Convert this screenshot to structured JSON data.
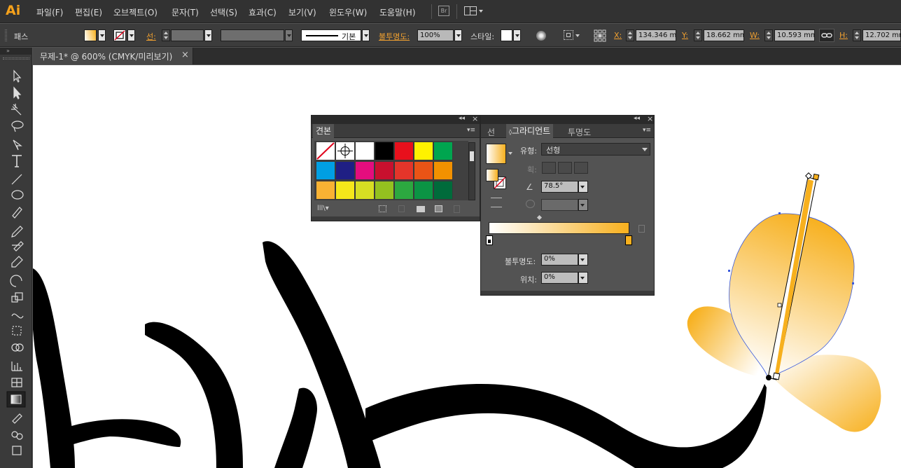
{
  "app": {
    "logo": "Ai"
  },
  "menu": [
    "파일(F)",
    "편집(E)",
    "오브젝트(O)",
    "문자(T)",
    "선택(S)",
    "효과(C)",
    "보기(V)",
    "윈도우(W)",
    "도움말(H)"
  ],
  "menu_icons": {
    "bridge": "Br"
  },
  "control": {
    "selection_label": "패스",
    "stroke_label": "선:",
    "stroke_style": "기본",
    "opacity_label": "불투명도:",
    "opacity_value": "100%",
    "style_label": "스타일:",
    "x_label": "X:",
    "x_value": "134.346 mm",
    "y_label": "Y:",
    "y_value": "18.662 mm",
    "w_label": "W:",
    "w_value": "10.593 mm",
    "h_label": "H:",
    "h_value": "12.702 mm"
  },
  "document_tab": {
    "title": "무제-1* @ 600% (CMYK/미리보기)",
    "close": "×"
  },
  "tools": [
    "selection-icon",
    "direct-selection-icon",
    "magic-wand-icon",
    "lasso-icon",
    "pen-icon",
    "type-icon",
    "line-icon",
    "ellipse-icon",
    "paintbrush-icon",
    "pencil-icon",
    "blob-brush-icon",
    "eraser-icon",
    "rotate-icon",
    "scale-icon",
    "width-icon",
    "free-transform-icon",
    "shape-builder-icon",
    "graph-icon",
    "mesh-icon",
    "gradient-icon",
    "eyedropper-icon",
    "blend-icon",
    "symbol-sprayer-icon"
  ],
  "swatches_panel": {
    "tab": "견본",
    "colors": [
      "none",
      "registration",
      "#ffffff",
      "#000000",
      "#e8101c",
      "#fff200",
      "#00a54f",
      "#009fe3",
      "#1f1f84",
      "#e40d7e",
      "#c8102e",
      "#e4352a",
      "#ea5416",
      "#f29100",
      "#f9b233",
      "#f5e71a",
      "#d6de23",
      "#94c11f",
      "#2ca840",
      "#0b9444",
      "#006b3b"
    ]
  },
  "gradient_panel": {
    "tabs": [
      "선",
      "그라디언트",
      "투명도"
    ],
    "type_label": "유형:",
    "type_value": "선형",
    "stroke_label": "획:",
    "angle_value": "78.5°",
    "opacity_label": "불투명도:",
    "opacity_value": "0%",
    "location_label": "위치:",
    "location_value": "0%",
    "colors": {
      "start": "#ffffff",
      "end": "#f7b01e"
    }
  }
}
